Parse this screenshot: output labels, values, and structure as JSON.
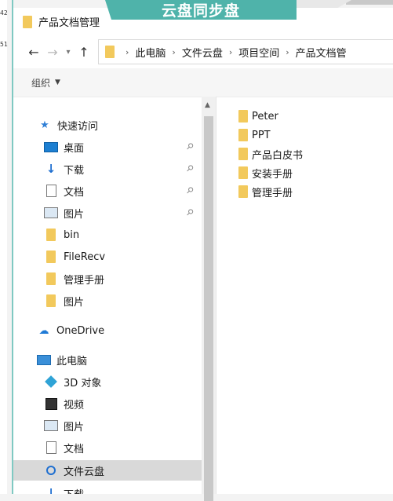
{
  "background": {
    "banner": "云盘同步盘",
    "line_numbers": [
      "42",
      "51"
    ]
  },
  "window": {
    "title": "产品文档管理",
    "address": [
      "此电脑",
      "文件云盘",
      "项目空间",
      "产品文档管"
    ]
  },
  "commandbar": {
    "organize": "组织"
  },
  "nav": {
    "quick_access": "快速访问",
    "desktop": "桌面",
    "downloads": "下载",
    "documents": "文档",
    "pictures": "图片",
    "bin": "bin",
    "filerecv": "FileRecv",
    "manuals": "管理手册",
    "pictures2": "图片",
    "onedrive": "OneDrive",
    "this_pc": "此电脑",
    "objects3d": "3D 对象",
    "videos": "视频",
    "pictures3": "图片",
    "documents2": "文档",
    "cloud": "文件云盘",
    "downloads2": "下载"
  },
  "files": [
    "Peter",
    "PPT",
    "产品白皮书",
    "安装手册",
    "管理手册"
  ]
}
